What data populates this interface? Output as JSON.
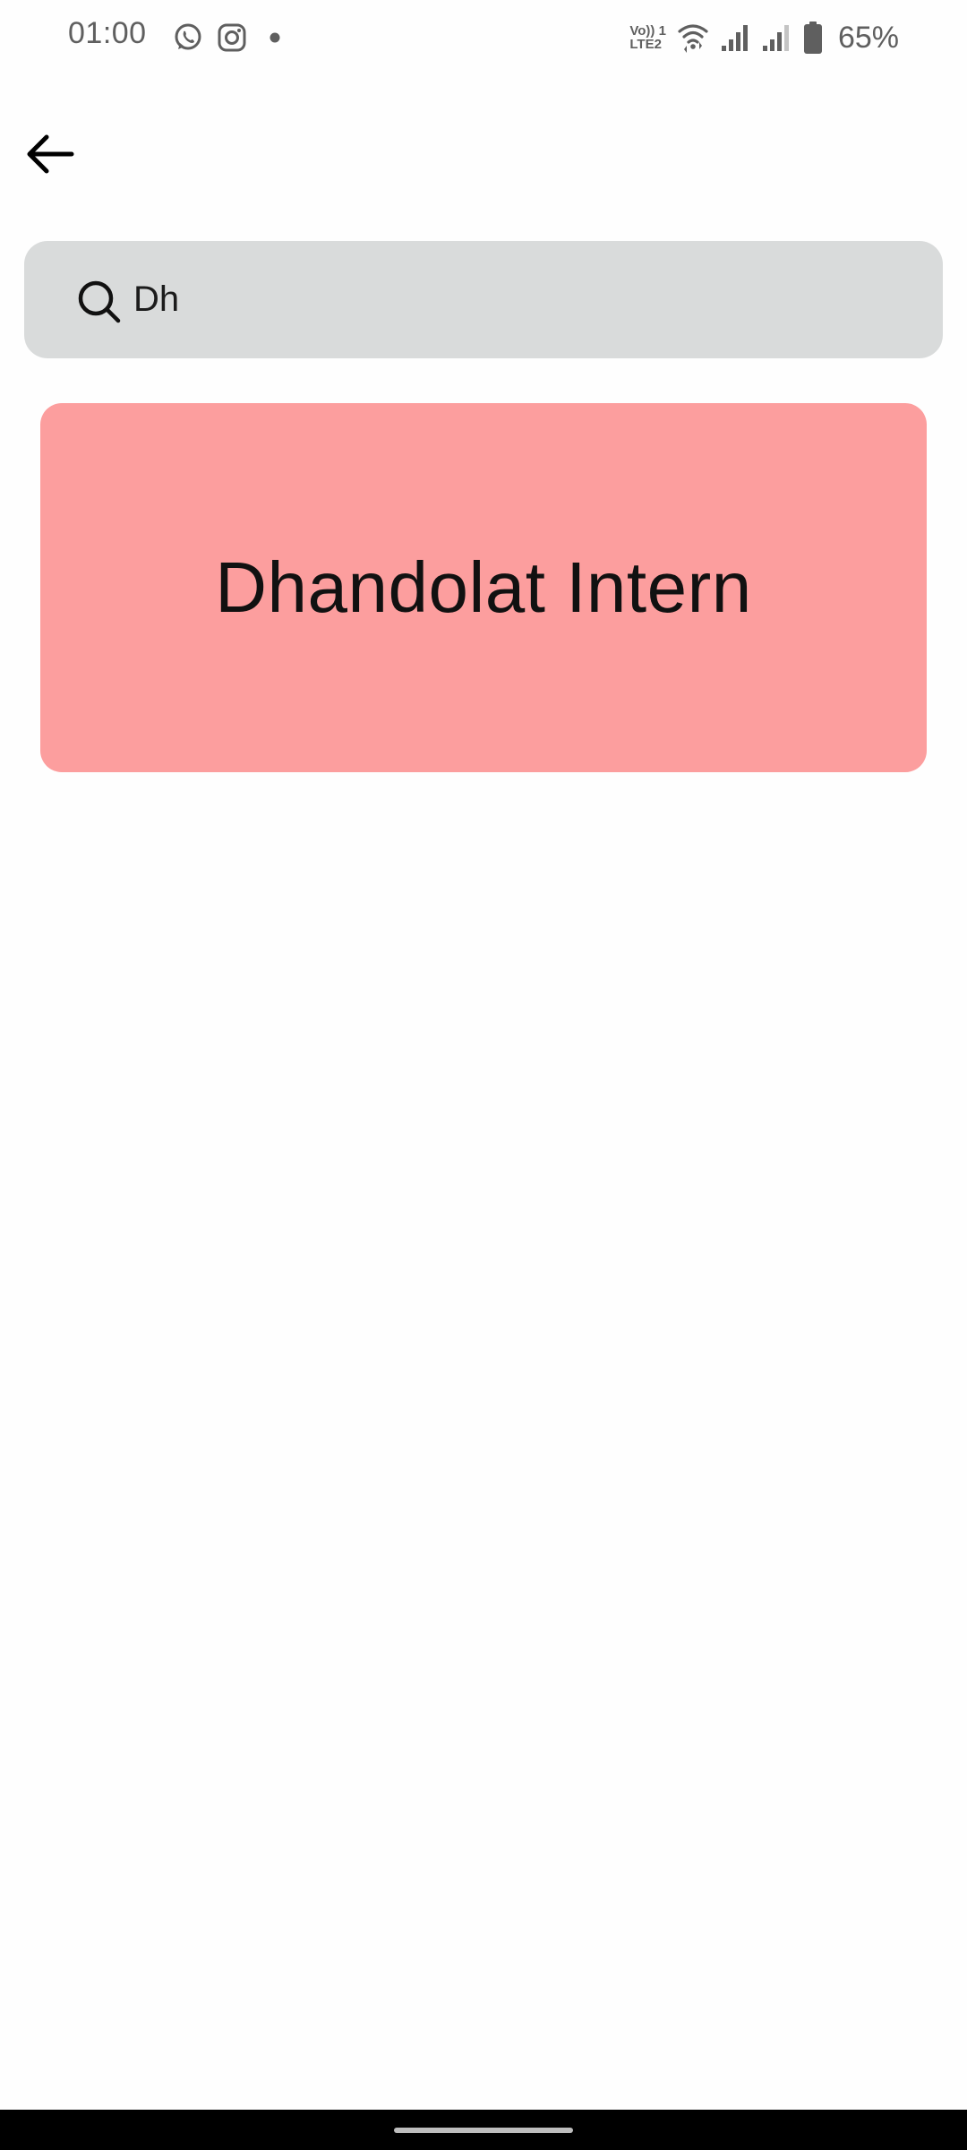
{
  "status_bar": {
    "time": "01:00",
    "lte_line1": "Vo)) 1",
    "lte_line2": "LTE2",
    "battery_percent": "65%",
    "notification_icons": [
      "whatsapp-icon",
      "instagram-icon",
      "dot-icon"
    ],
    "system_icons": [
      "volte-icon",
      "wifi-icon",
      "signal-icon",
      "signal-icon",
      "battery-icon"
    ]
  },
  "header": {
    "back_icon": "arrow-left-icon"
  },
  "search": {
    "icon": "search-icon",
    "value": "Dh"
  },
  "results": [
    {
      "label": "Dhandolat Intern",
      "color": "#fc9e9e"
    }
  ],
  "colors": {
    "background": "#fefefe",
    "search_background": "#d9dbdb",
    "card_background": "#fc9e9e",
    "nav_bar": "#000000"
  }
}
